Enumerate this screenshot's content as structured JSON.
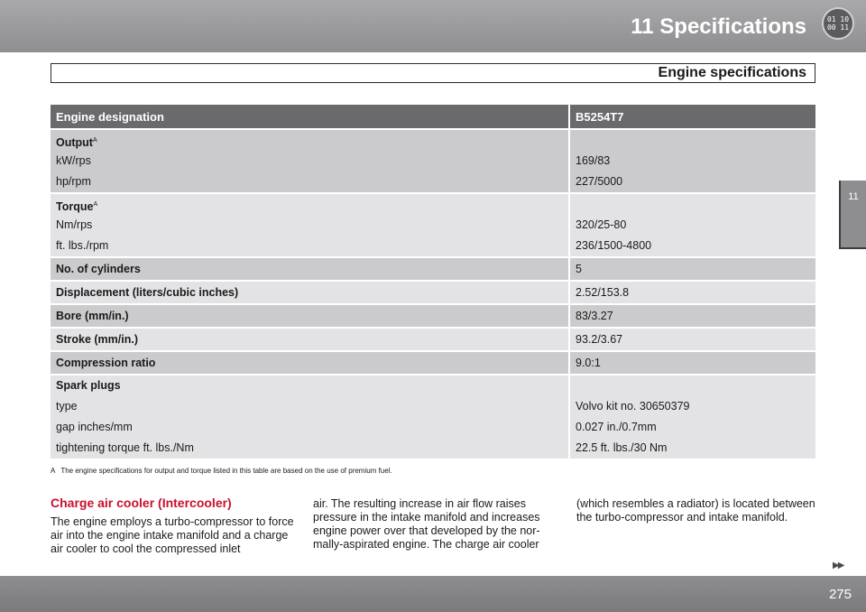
{
  "header": {
    "chapter_title": "11 Specifications",
    "section_title": "Engine specifications"
  },
  "side_tab": {
    "label": "11"
  },
  "table": {
    "headers": [
      "Engine designation",
      "B5254T7"
    ],
    "output": {
      "label": "Output",
      "note": "A",
      "rows": [
        [
          "kW/rps",
          "169/83"
        ],
        [
          "hp/rpm",
          "227/5000"
        ]
      ]
    },
    "torque": {
      "label": "Torque",
      "note": "A",
      "rows": [
        [
          "Nm/rps",
          "320/25-80"
        ],
        [
          "ft. lbs./rpm",
          "236/1500-4800"
        ]
      ]
    },
    "cylinders": [
      "No. of cylinders",
      "5"
    ],
    "displacement": [
      "Displacement (liters/cubic inches)",
      "2.52/153.8"
    ],
    "bore": [
      "Bore (mm/in.)",
      "83/3.27"
    ],
    "stroke": [
      "Stroke (mm/in.)",
      "93.2/3.67"
    ],
    "compression": [
      "Compression ratio",
      "9.0:1"
    ],
    "spark": {
      "label": "Spark plugs",
      "rows": [
        [
          "type",
          "Volvo kit no. 30650379"
        ],
        [
          "gap inches/mm",
          "0.027 in./0.7mm"
        ],
        [
          "tightening torque ft. lbs./Nm",
          "22.5 ft. lbs./30 Nm"
        ]
      ]
    }
  },
  "footnote": {
    "marker": "A",
    "text": "The engine specifications for output and torque listed in this table are based on the use of premium fuel."
  },
  "body": {
    "heading": "Charge air cooler (Intercooler)",
    "col1": "The engine employs a turbo-compressor to force air into the engine intake manifold and a charge air cooler to cool the compressed inlet",
    "col2": "air. The resulting increase in air flow raises pressure in the intake manifold and increases engine power over that developed by the nor- mally-aspirated engine. The charge air cooler",
    "col3": "(which resembles a radiator) is located between the turbo-compressor and intake manifold."
  },
  "footer": {
    "page_number": "275",
    "next_arrows": "▶▶"
  }
}
